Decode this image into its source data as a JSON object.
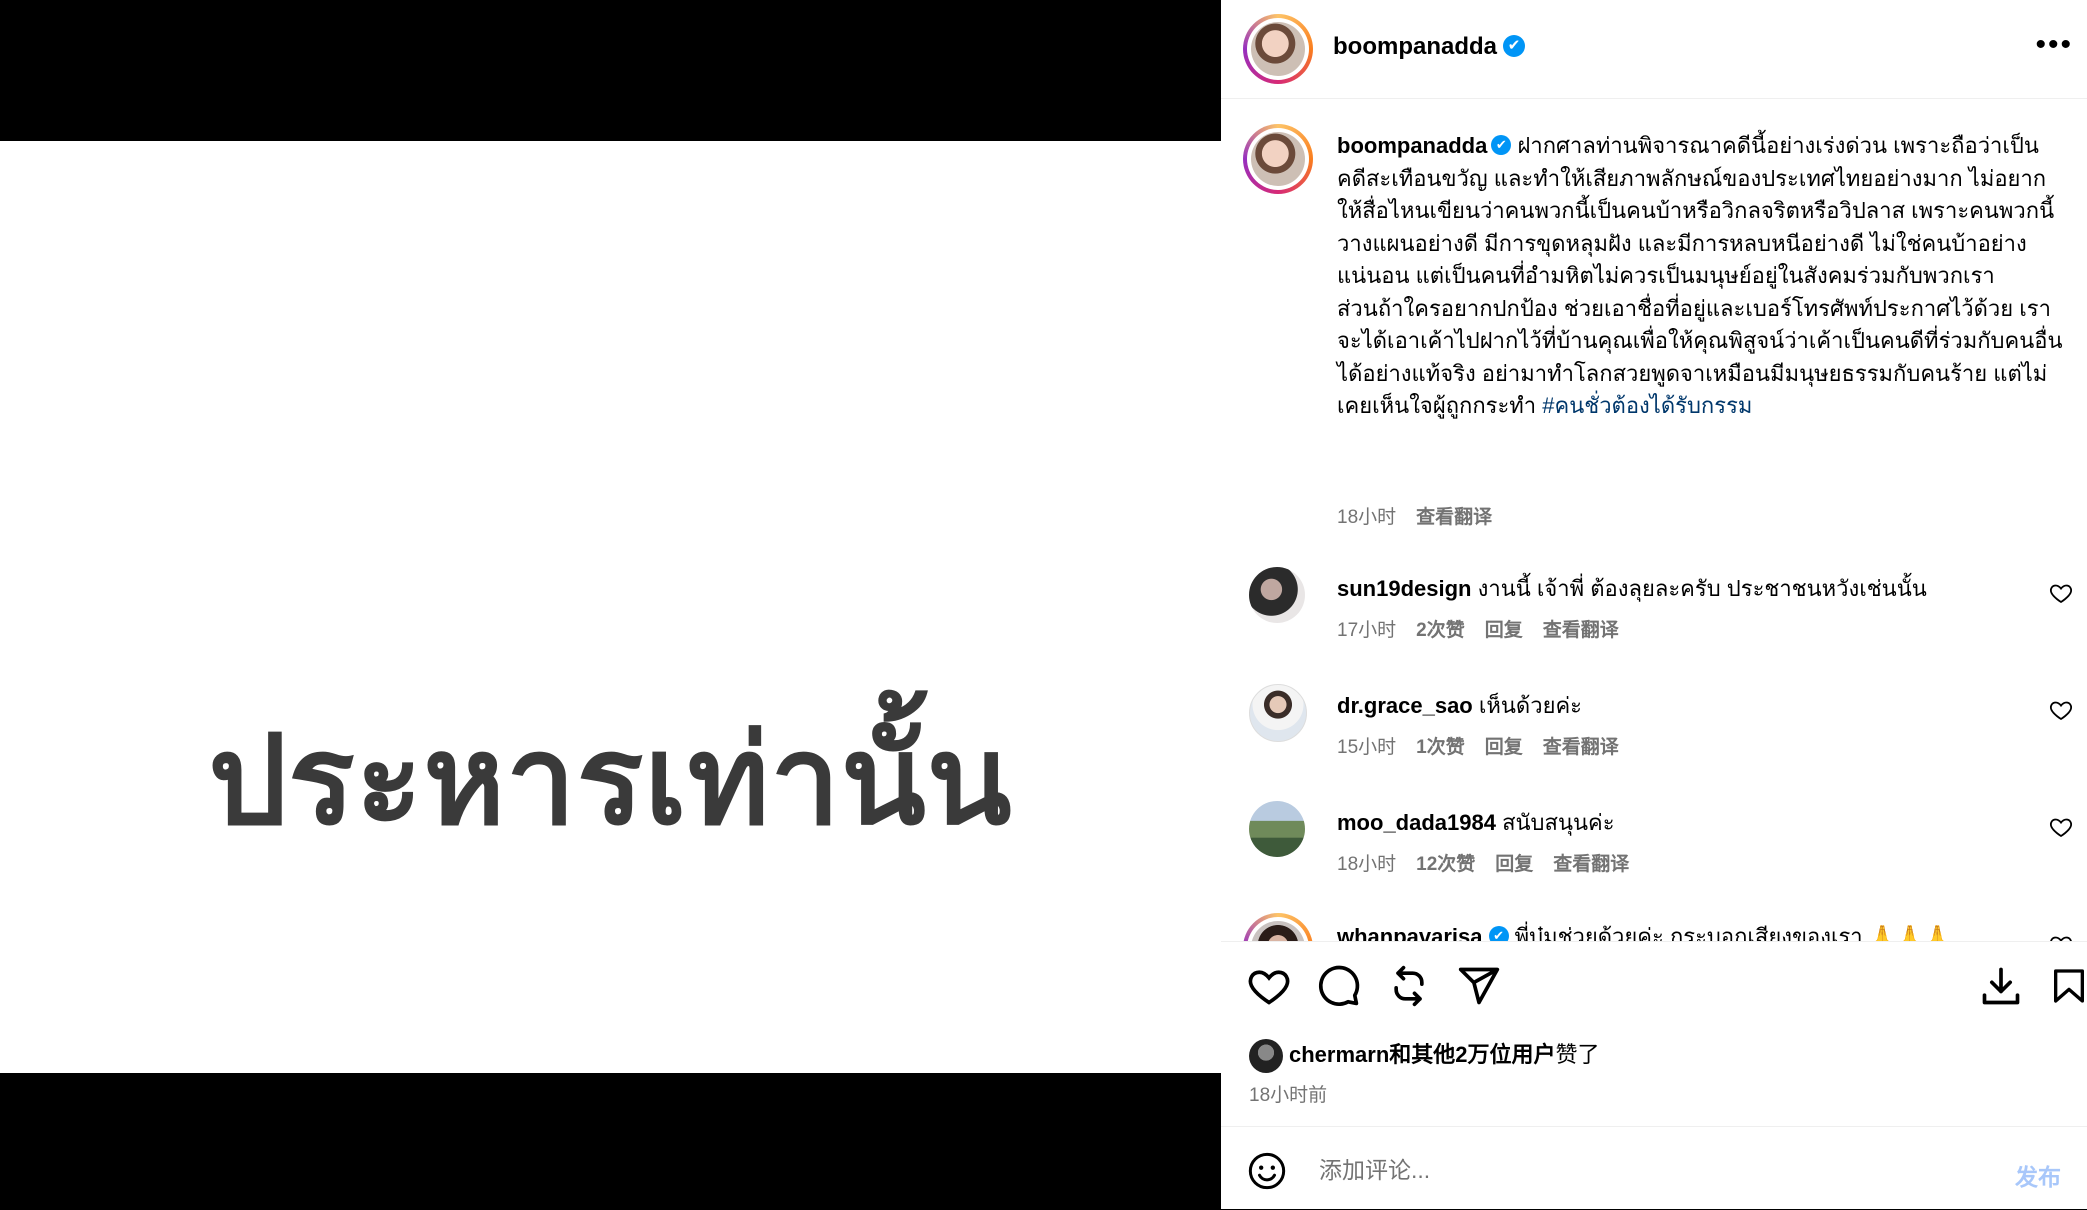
{
  "media": {
    "text": "ประหารเท่านั้น"
  },
  "header": {
    "username": "boompanadda",
    "verified_icon": "verified-check-icon",
    "more_icon": "more-horizontal-icon"
  },
  "caption": {
    "username": "boompanadda",
    "text": " ฝากศาลท่านพิจารณาคดีนี้อย่างเร่งด่วน เพราะถือว่าเป็นคดีสะเทือนขวัญ และทำให้เสียภาพลักษณ์ของประเทศไทยอย่างมาก ไม่อยากให้สื่อไหนเขียนว่าคนพวกนี้เป็นคนบ้าหรือวิกลจริตหรือวิปลาส เพราะคนพวกนี้วางแผนอย่างดี มีการขุดหลุมฝัง และมีการหลบหนีอย่างดี ไม่ใช่คนบ้าอย่างแน่นอน แต่เป็นคนที่อำมหิตไม่ควรเป็นมนุษย์อยู่ในสังคมร่วมกับพวกเรา\nส่วนถ้าใครอยากปกป้อง ช่วยเอาชื่อที่อยู่และเบอร์โทรศัพท์ประกาศไว้ด้วย เราจะได้เอาเค้าไปฝากไว้ที่บ้านคุณเพื่อให้คุณพิสูจน์ว่าเค้าเป็นคนดีที่ร่วมกับคนอื่นได้อย่างแท้จริง อย่ามาทำโลกสวยพูดจาเหมือนมีมนุษยธรรมกับคนร้าย แต่ไม่เคยเห็นใจผู้ถูกกระทำ ",
    "hashtag": "#คนชั่วต้องได้รับกรรม",
    "time": "18小时",
    "translate": "查看翻译"
  },
  "comments": [
    {
      "username": "sun19design",
      "text": " งานนี้ เจ้าพี่ ต้องลุยละครับ ประชาชนหวังเช่นนั้น",
      "time": "17小时",
      "likes": "2次赞",
      "reply": "回复",
      "translate": "查看翻译"
    },
    {
      "username": "dr.grace_sao",
      "text": " เห็นด้วยค่ะ",
      "time": "15小时",
      "likes": "1次赞",
      "reply": "回复",
      "translate": "查看翻译"
    },
    {
      "username": "moo_dada1984",
      "text": " สนับสนุนค่ะ",
      "time": "18小时",
      "likes": "12次赞",
      "reply": "回复",
      "translate": "查看翻译"
    },
    {
      "username": "whanpavarisa",
      "text": " พี่บุ๋มช่วยด้วยค่ะ กระบอกเสียงของเรา 🙏🙏🙏"
    }
  ],
  "actions": {
    "like_icon": "heart-icon",
    "comment_icon": "comment-icon",
    "repost_icon": "repost-icon",
    "share_icon": "send-icon",
    "download_icon": "download-icon",
    "save_icon": "bookmark-icon"
  },
  "likes": {
    "user": "chermarn",
    "rest": "和其他2万位用户",
    "suffix": "赞了"
  },
  "post_time": "18小时前",
  "composer": {
    "placeholder": "添加评论...",
    "post_label": "发布",
    "post_color": "#a8c7fa"
  }
}
